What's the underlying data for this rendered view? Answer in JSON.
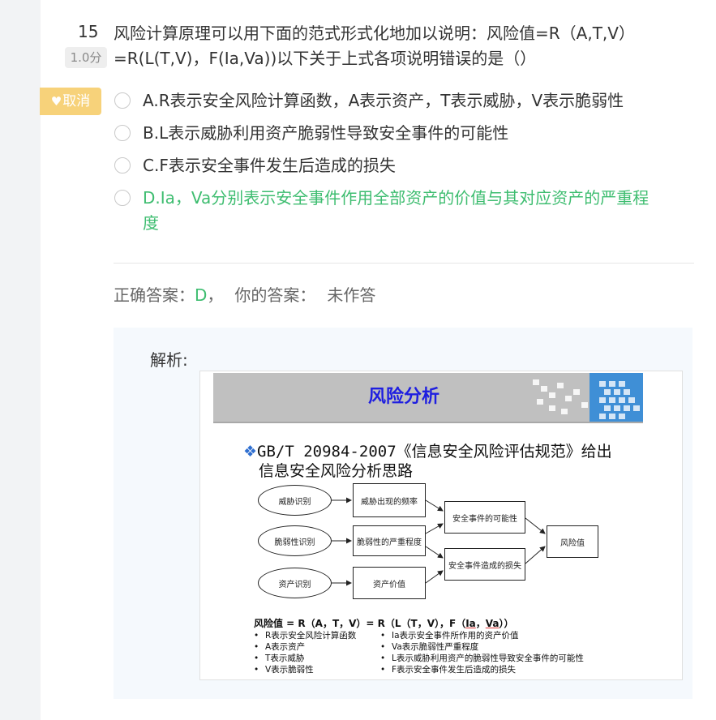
{
  "question": {
    "number": "15",
    "score": "1.0分",
    "text": "风险计算原理可以用下面的范式形式化地加以说明：风险值=R（A,T,V）=R(L(T,V)，F(Ia,Va))以下关于上式各项说明错误的是（）"
  },
  "favorite_button": {
    "icon": "heart-icon",
    "label": "取消"
  },
  "options": [
    {
      "text": "A.R表示安全风险计算函数，A表示资产，T表示威胁，V表示脆弱性"
    },
    {
      "text": "B.L表示威胁利用资产脆弱性导致安全事件的可能性"
    },
    {
      "text": "C.F表示安全事件发生后造成的损失"
    },
    {
      "text": "D.Ia，Va分别表示安全事件作用全部资产的价值与其对应资产的严重程度"
    }
  ],
  "answer": {
    "correct_label": "正确答案：",
    "correct_value": "D",
    "separator": "，",
    "yours_label": "你的答案：",
    "yours_value": "未作答"
  },
  "analysis": {
    "label": "解析:",
    "slide": {
      "title": "风险分析",
      "bullet_line1": "GB/T 20984-2007《信息安全风险评估规范》给出",
      "bullet_line2": "信息安全风险分析思路",
      "nodes": {
        "threat_id": "威胁识别",
        "threat_freq": "威胁出现的频率",
        "vuln_id": "脆弱性识别",
        "vuln_severity": "脆弱性的严重程度",
        "asset_id": "资产识别",
        "asset_value": "资产价值",
        "event_likelihood": "安全事件的可能性",
        "event_loss": "安全事件造成的损失",
        "risk_value": "风险值"
      },
      "formula_prefix": "风险值 = R（A，T，V）= R（L（T，V），F（",
      "formula_ia": "Ia",
      "formula_mid": "，",
      "formula_va": "Va",
      "formula_suffix": "））",
      "legend_left": [
        "R表示安全风险计算函数",
        "A表示资产",
        "T表示威胁",
        "V表示脆弱性"
      ],
      "legend_right": [
        "Ia表示安全事件所作用的资产价值",
        "Va表示脆弱性严重程度",
        "L表示威胁利用资产的脆弱性导致安全事件的可能性",
        "F表示安全事件发生后造成的损失"
      ]
    }
  },
  "colors": {
    "correct": "#3ebd70",
    "favorite": "#f7d27a",
    "slide_title": "#1e1ee0",
    "slide_accent": "#3f8fd6"
  }
}
